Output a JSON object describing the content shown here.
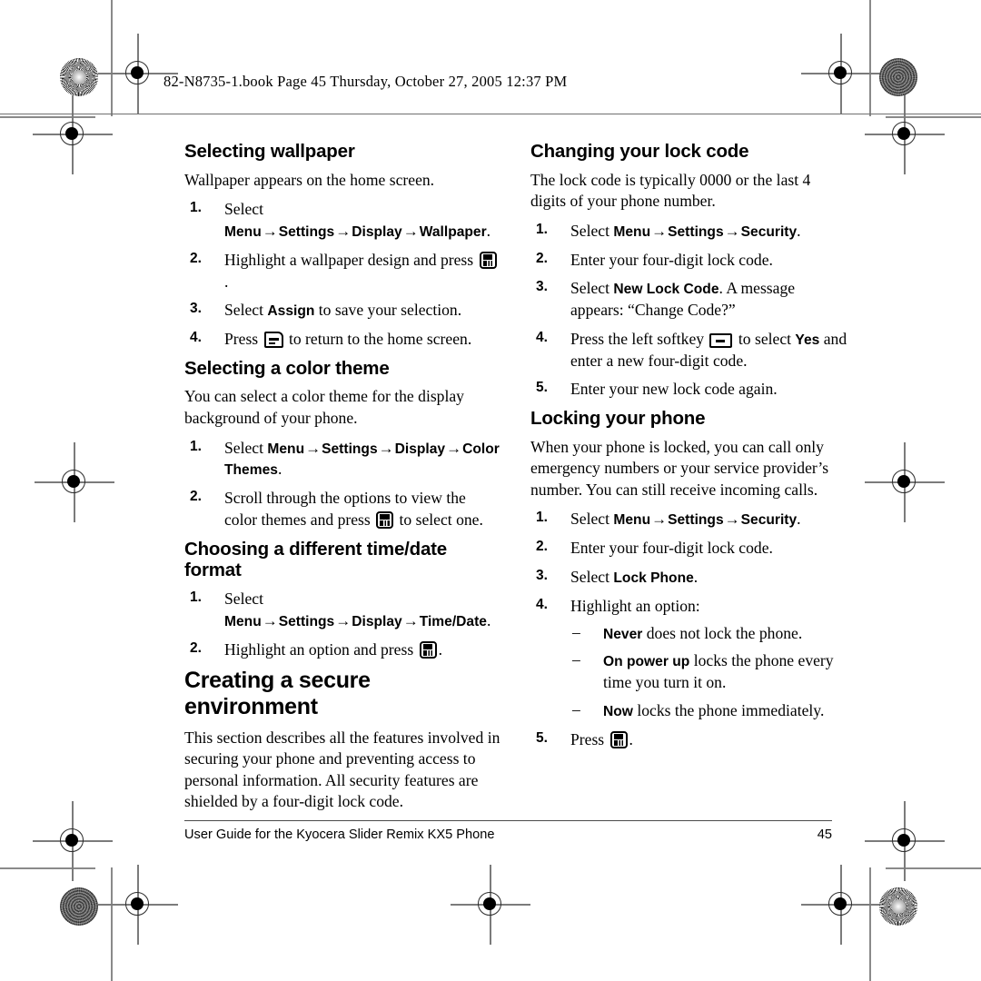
{
  "header": {
    "text": "82-N8735-1.book  Page 45  Thursday, October 27, 2005  12:37 PM"
  },
  "footer": {
    "title": "User Guide for the Kyocera Slider Remix KX5 Phone",
    "page_number": "45"
  },
  "icons": {
    "ok_key": "ok-key-icon",
    "end_key": "end-call-key-icon",
    "softkey": "left-softkey-icon",
    "registration_mark": "registration-crosshair-mark",
    "burst_patch": "starburst-density-patch",
    "dense_patch": "halftone-density-patch"
  },
  "arrow": "→",
  "dash": "–",
  "left_column": {
    "sections": [
      {
        "heading": "Selecting wallpaper",
        "intro": "Wallpaper appears on the home screen.",
        "steps": [
          {
            "num": "1.",
            "pre": "Select ",
            "ui_path": [
              "Menu",
              "Settings",
              "Display",
              "Wallpaper"
            ],
            "post": "."
          },
          {
            "num": "2.",
            "pre": "Highlight a wallpaper design and press ",
            "icon": "ok_key",
            "post": "."
          },
          {
            "num": "3.",
            "pre": "Select ",
            "bold": "Assign",
            "post": " to save your selection."
          },
          {
            "num": "4.",
            "pre": "Press ",
            "icon": "end_key",
            "post": " to return to the home screen."
          }
        ]
      },
      {
        "heading": "Selecting a color theme",
        "intro": "You can select a color theme for the display background of your phone.",
        "steps": [
          {
            "num": "1.",
            "pre": "Select ",
            "ui_path": [
              "Menu",
              "Settings",
              "Display",
              "Color Themes"
            ],
            "post": "."
          },
          {
            "num": "2.",
            "pre": "Scroll through the options to view the color themes and press ",
            "icon": "ok_key",
            "post": " to select one."
          }
        ]
      },
      {
        "heading": "Choosing a different time/date format",
        "intro": "",
        "steps": [
          {
            "num": "1.",
            "pre": "Select ",
            "ui_path": [
              "Menu",
              "Settings",
              "Display",
              "Time/Date"
            ],
            "post": "."
          },
          {
            "num": "2.",
            "pre": "Highlight an option and press ",
            "icon": "ok_key",
            "post": "."
          }
        ]
      }
    ],
    "chapter": {
      "heading": "Creating a secure environment",
      "body": "This section describes all the features involved in securing your phone and preventing access to personal information. All security features are shielded by a four-digit lock code."
    }
  },
  "right_column": {
    "sections": [
      {
        "heading": "Changing your lock code",
        "intro": "The lock code is typically 0000 or the last 4 digits of your phone number.",
        "steps": [
          {
            "num": "1.",
            "pre": "Select ",
            "ui_path": [
              "Menu",
              "Settings",
              "Security"
            ],
            "post": "."
          },
          {
            "num": "2.",
            "pre": "Enter your four-digit lock code.",
            "post": ""
          },
          {
            "num": "3.",
            "pre": "Select ",
            "bold": "New Lock Code",
            "post": ". A message appears: “Change Code?”"
          },
          {
            "num": "4.",
            "pre": "Press the left softkey ",
            "icon": "softkey",
            "mid": " to select ",
            "bold": "Yes",
            "post": " and enter a new four-digit code."
          },
          {
            "num": "5.",
            "pre": "Enter your new lock code again.",
            "post": ""
          }
        ]
      },
      {
        "heading": "Locking your phone",
        "intro": "When your phone is locked, you can call only emergency numbers or your service provider’s number. You can still receive incoming calls.",
        "steps": [
          {
            "num": "1.",
            "pre": "Select ",
            "ui_path": [
              "Menu",
              "Settings",
              "Security"
            ],
            "post": "."
          },
          {
            "num": "2.",
            "pre": "Enter your four-digit lock code.",
            "post": ""
          },
          {
            "num": "3.",
            "pre": "Select ",
            "bold": "Lock Phone",
            "post": "."
          },
          {
            "num": "4.",
            "pre": "Highlight an option:",
            "post": "",
            "sub_items": [
              {
                "bold": "Never",
                "text": " does not lock the phone."
              },
              {
                "bold": "On power up",
                "text": " locks the phone every time you turn it on."
              },
              {
                "bold": "Now",
                "text": " locks the phone immediately."
              }
            ]
          },
          {
            "num": "5.",
            "pre": "Press ",
            "icon": "ok_key",
            "post": "."
          }
        ]
      }
    ]
  }
}
